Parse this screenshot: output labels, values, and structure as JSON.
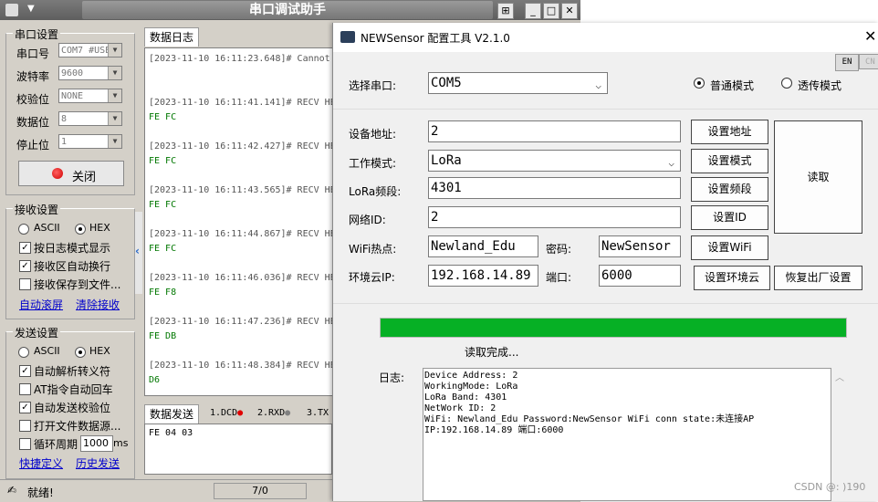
{
  "back_window": {
    "title": "串口调试助手",
    "serial_group": {
      "title": "串口设置",
      "rows": [
        {
          "label": "串口号",
          "value": "COM7 #USE"
        },
        {
          "label": "波特率",
          "value": "9600"
        },
        {
          "label": "校验位",
          "value": "NONE"
        },
        {
          "label": "数据位",
          "value": "8"
        },
        {
          "label": "停止位",
          "value": "1"
        }
      ],
      "close_button": "关闭"
    },
    "recv_group": {
      "title": "接收设置",
      "ascii": "ASCII",
      "hex": "HEX",
      "checks": [
        {
          "label": "按日志模式显示",
          "checked": true
        },
        {
          "label": "接收区自动换行",
          "checked": true
        },
        {
          "label": "接收保存到文件...",
          "checked": false
        }
      ],
      "link_autoscroll": "自动滚屏",
      "link_clear": "清除接收"
    },
    "send_group": {
      "title": "发送设置",
      "ascii": "ASCII",
      "hex": "HEX",
      "checks": [
        {
          "label": "自动解析转义符",
          "checked": true
        },
        {
          "label": "AT指令自动回车",
          "checked": false
        },
        {
          "label": "自动发送校验位",
          "checked": true
        },
        {
          "label": "打开文件数据源...",
          "checked": false
        },
        {
          "label": "循环周期",
          "checked": false
        }
      ],
      "cycle_value": "1000",
      "cycle_unit": "ms",
      "link_shortcut": "快捷定义",
      "link_history": "历史发送"
    },
    "log_tab": "数据日志",
    "log_entries": [
      {
        "ts": "[2023-11-10 16:11:23.648]# Cannot",
        "data": ""
      },
      {
        "ts": "[2023-11-10 16:11:41.141]# RECV HE",
        "data": "FE FC"
      },
      {
        "ts": "[2023-11-10 16:11:42.427]# RECV HE",
        "data": "FE FC"
      },
      {
        "ts": "[2023-11-10 16:11:43.565]# RECV HE",
        "data": "FE FC"
      },
      {
        "ts": "[2023-11-10 16:11:44.867]# RECV HE",
        "data": "FE FC"
      },
      {
        "ts": "[2023-11-10 16:11:46.036]# RECV HE",
        "data": "FE F8"
      },
      {
        "ts": "[2023-11-10 16:11:47.236]# RECV HE",
        "data": "FE DB"
      },
      {
        "ts": "[2023-11-10 16:11:48.384]# RECV HE",
        "data": "D6"
      }
    ],
    "send_tab": "数据发送",
    "indicators": [
      {
        "label": "1.DCD",
        "color": "#e00000"
      },
      {
        "label": "2.RXD",
        "color": "#808080"
      },
      {
        "label": "3.TX",
        "color": "#808080"
      }
    ],
    "send_text": "FE 04 03",
    "status_text": "就绪!",
    "status_count": "7/0"
  },
  "dialog": {
    "title": "NEWSensor 配置工具 V2.1.0",
    "lang_en": "EN",
    "lang_cn": "CN",
    "port_label": "选择串口:",
    "port_value": "COM5",
    "mode_normal": "普通模式",
    "mode_transparent": "透传模式",
    "fields": {
      "addr_label": "设备地址:",
      "addr_value": "2",
      "addr_btn": "设置地址",
      "mode_label": "工作模式:",
      "mode_value": "LoRa",
      "mode_btn": "设置模式",
      "band_label": "LoRa频段:",
      "band_value": "4301",
      "band_btn": "设置频段",
      "net_label": "网络ID:",
      "net_value": "2",
      "net_btn": "设置ID",
      "wifi_label": "WiFi热点:",
      "wifi_value": "Newland_Edu",
      "pwd_label": "密码:",
      "pwd_value": "NewSensor",
      "wifi_btn": "设置WiFi",
      "ip_label": "环境云IP:",
      "ip_value": "192.168.14.89",
      "port2_label": "端口:",
      "port2_value": "6000",
      "ip_btn": "设置环境云"
    },
    "read_btn": "读取",
    "factory_btn": "恢复出厂设置",
    "progress": 1.0,
    "progress_color": "#06b025",
    "status": "读取完成...",
    "log_label": "日志:",
    "log_lines": [
      "Device Address: 2",
      "WorkingMode: LoRa",
      "LoRa Band: 4301",
      "NetWork ID: 2",
      "WiFi: Newland_Edu Password:NewSensor WiFi conn state:未连接AP",
      "IP:192.168.14.89 端口:6000"
    ]
  },
  "watermark": "CSDN @: )190"
}
